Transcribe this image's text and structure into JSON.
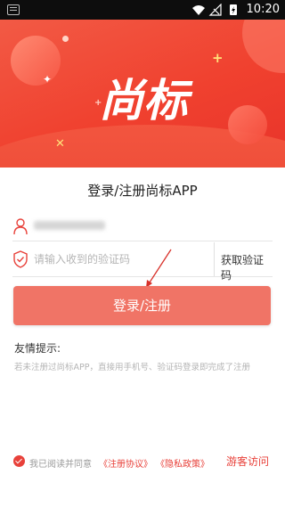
{
  "status_bar": {
    "time": "10:20"
  },
  "banner": {
    "logo_text": "尚标"
  },
  "title": "登录/注册尚标APP",
  "form": {
    "phone_value": "18271234568",
    "code_placeholder": "请输入收到的验证码",
    "get_code_label": "获取验证码"
  },
  "login_button": "登录/注册",
  "tips": {
    "title": "友情提示:",
    "text": "若未注册过尚标APP，直接用手机号、验证码登录即完成了注册"
  },
  "agreement": {
    "prefix": "我已阅读并同意",
    "terms": "《注册协议》",
    "privacy": "《隐私政策》"
  },
  "guest_label": "游客访问",
  "colors": {
    "accent": "#e8413a",
    "button": "#f07466",
    "banner": "#f0412f"
  }
}
